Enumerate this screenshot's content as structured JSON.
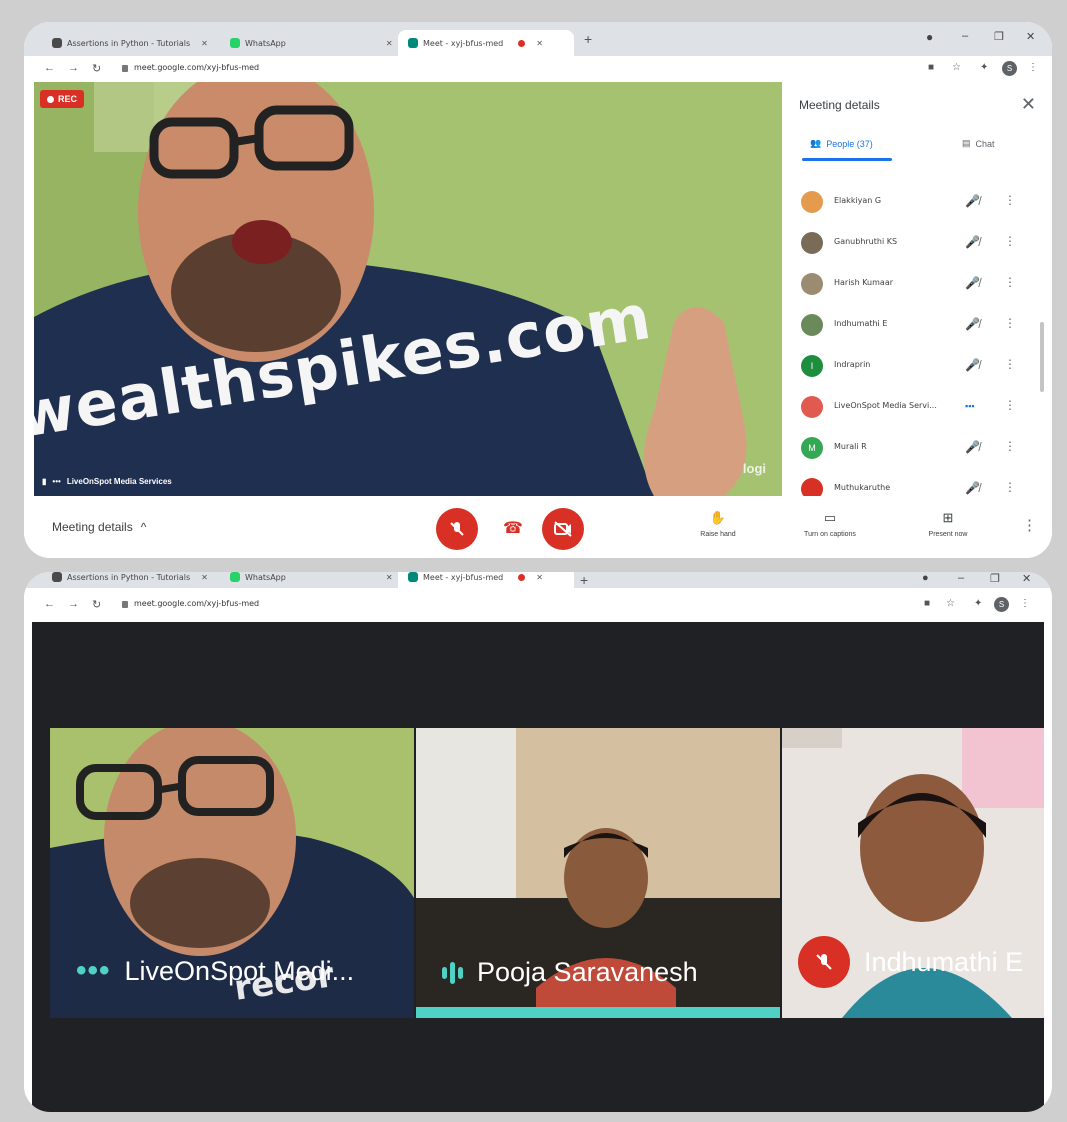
{
  "top_window": {
    "tabs": [
      {
        "title": "Assertions in Python - Tutorials",
        "favicon_color": "#4a4a4a"
      },
      {
        "title": "WhatsApp",
        "favicon_color": "#25d366"
      },
      {
        "title": "Meet - xyj-bfus-med",
        "favicon_color": "#00897b"
      }
    ],
    "url": "meet.google.com/xyj-bfus-med",
    "rec_label": "REC",
    "main_video": {
      "shirt_text": "wealthspikes.com",
      "speaker": "LiveOnSpot Media Services",
      "watermark": "logi"
    },
    "side_panel": {
      "title": "Meeting details",
      "people_tab": "People (37)",
      "chat_tab": "Chat",
      "people": [
        {
          "name": "Elakkiyan G",
          "initial": "",
          "color": "#e59b4d",
          "mic": "muted"
        },
        {
          "name": "Ganubhruthi KS",
          "initial": "",
          "color": "#7a6a58",
          "mic": "muted"
        },
        {
          "name": "Harish Kumaar",
          "initial": "",
          "color": "#9b8b70",
          "mic": "muted"
        },
        {
          "name": "Indhumathi E",
          "initial": "",
          "color": "#6a8a5a",
          "mic": "muted"
        },
        {
          "name": "Indraprin",
          "initial": "I",
          "color": "#1e8e3e",
          "mic": "muted"
        },
        {
          "name": "LiveOnSpot Media Servi...",
          "initial": "",
          "color": "#e05a4f",
          "mic": "on"
        },
        {
          "name": "Murali R",
          "initial": "M",
          "color": "#34a853",
          "mic": "muted"
        },
        {
          "name": "Muthukaruthe",
          "initial": "",
          "color": "#d93025",
          "mic": "muted"
        }
      ]
    },
    "bottom_bar": {
      "meeting_details": "Meeting details",
      "raise_hand": "Raise hand",
      "captions": "Turn on captions",
      "present": "Present now"
    },
    "colors": {
      "accent": "#1a73e8",
      "danger": "#d93025"
    }
  },
  "bottom_window": {
    "tabs": [
      {
        "title": "Assertions in Python - Tutorials",
        "favicon_color": "#4a4a4a"
      },
      {
        "title": "WhatsApp",
        "favicon_color": "#25d366"
      },
      {
        "title": "Meet - xyj-bfus-med",
        "favicon_color": "#00897b"
      }
    ],
    "url": "meet.google.com/xyj-bfus-med",
    "tiles": [
      {
        "name": "LiveOnSpot Medi...",
        "indicator": "dots",
        "shirt_text": "recor"
      },
      {
        "name": "Pooja Saravanesh",
        "indicator": "speaking"
      },
      {
        "name": "Indhumathi E",
        "indicator": "muted"
      }
    ],
    "colors": {
      "speaking": "#4fd1c5",
      "muted": "#d93025"
    }
  }
}
